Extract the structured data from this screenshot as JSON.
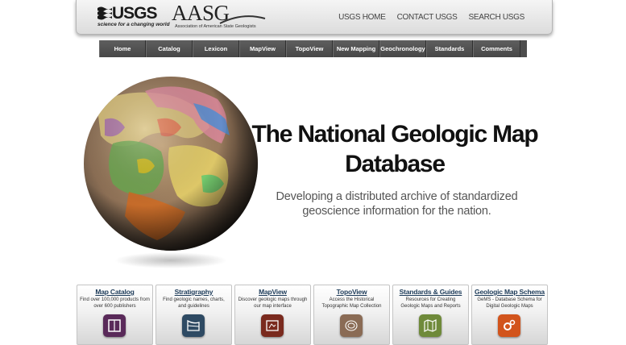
{
  "header": {
    "usgs_logo_text": "USGS",
    "usgs_tagline": "science for a changing world",
    "aasg_logo_text": "AASG",
    "aasg_subtitle": "Association of American State Geologists",
    "links": [
      "USGS HOME",
      "CONTACT USGS",
      "SEARCH USGS"
    ]
  },
  "nav": {
    "items": [
      "Home",
      "Catalog",
      "Lexicon",
      "MapView",
      "TopoView",
      "New Mapping",
      "Geochronology",
      "Standards",
      "Comments"
    ]
  },
  "hero": {
    "title": "The National Geologic Map Database",
    "subtitle": "Developing a distributed archive of standardized geoscience information for the nation."
  },
  "cards": [
    {
      "title": "Map Catalog",
      "desc": "Find over 100,000 products from over 600 publishers",
      "icon": "book-icon",
      "color": "#5a2a5a"
    },
    {
      "title": "Stratigraphy",
      "desc": "Find geologic names, charts, and guidelines",
      "icon": "strata-icon",
      "color": "#2e4a63"
    },
    {
      "title": "MapView",
      "desc": "Discover geologic maps through our map interface",
      "icon": "map-window-icon",
      "color": "#7a2a1e"
    },
    {
      "title": "TopoView",
      "desc": "Access the Historical Topographic Map Collection",
      "icon": "topo-icon",
      "color": "#8a6b55"
    },
    {
      "title": "Standards & Guides",
      "desc": "Resources for Creating Geologic Maps and Reports",
      "icon": "folded-map-icon",
      "color": "#6f8a3a"
    },
    {
      "title": "Geologic Map Schema",
      "desc": "GeMS - Database Schema for Digital Geologic Maps",
      "icon": "gears-icon",
      "color": "#d2541c"
    }
  ]
}
